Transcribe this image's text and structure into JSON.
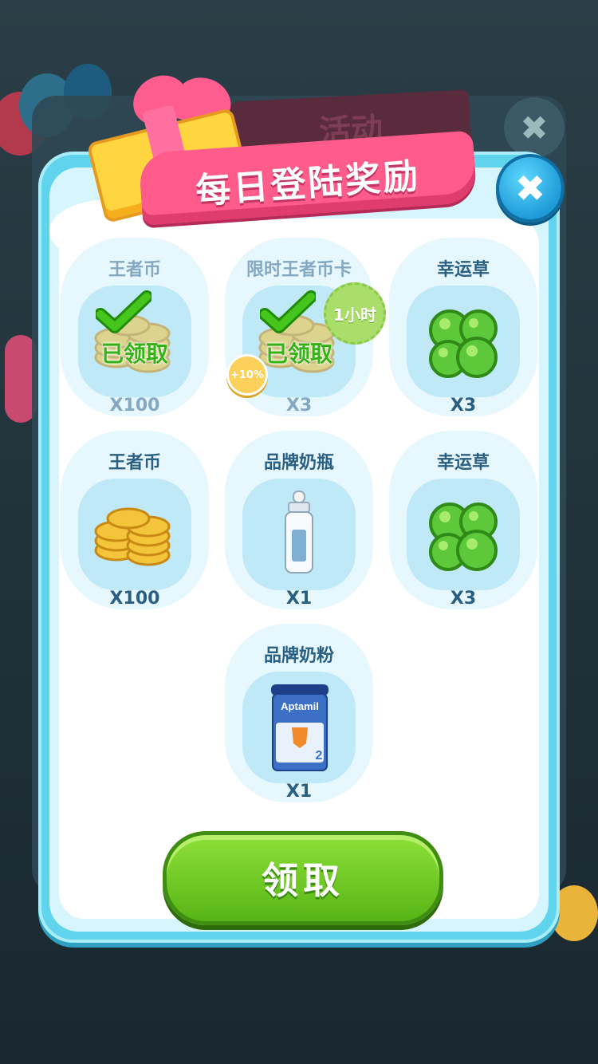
{
  "background": {
    "title": "活动",
    "close_symbol": "✖"
  },
  "popup": {
    "title": "每日登陆奖励",
    "close_symbol": "✖",
    "claim_label": "领取"
  },
  "rewards": [
    {
      "name": "王者币",
      "count": "X100",
      "icon": "gold-coins-icon",
      "claimed": true,
      "claimed_label": "已领取"
    },
    {
      "name": "限时王者币卡",
      "count": "X3",
      "icon": "gold-coins-icon",
      "claimed": true,
      "claimed_label": "已领取",
      "time_badge": "1小时",
      "bonus_badge": "+10%"
    },
    {
      "name": "幸运草",
      "count": "X3",
      "icon": "four-leaf-clover-icon",
      "claimed": false
    },
    {
      "name": "王者币",
      "count": "X100",
      "icon": "gold-coins-icon",
      "claimed": false
    },
    {
      "name": "品牌奶瓶",
      "count": "X1",
      "icon": "baby-bottle-icon",
      "claimed": false
    },
    {
      "name": "幸运草",
      "count": "X3",
      "icon": "four-leaf-clover-icon",
      "claimed": false
    },
    {
      "name": "品牌奶粉",
      "count": "X1",
      "icon": "formula-can-icon",
      "claimed": false,
      "product_brand": "Aptamil",
      "product_stage": "2"
    }
  ],
  "colors": {
    "panel": "#5fd4ec",
    "banner": "#ff5c8c",
    "claim_button": "#56b516",
    "claimed_text": "#35b316"
  }
}
